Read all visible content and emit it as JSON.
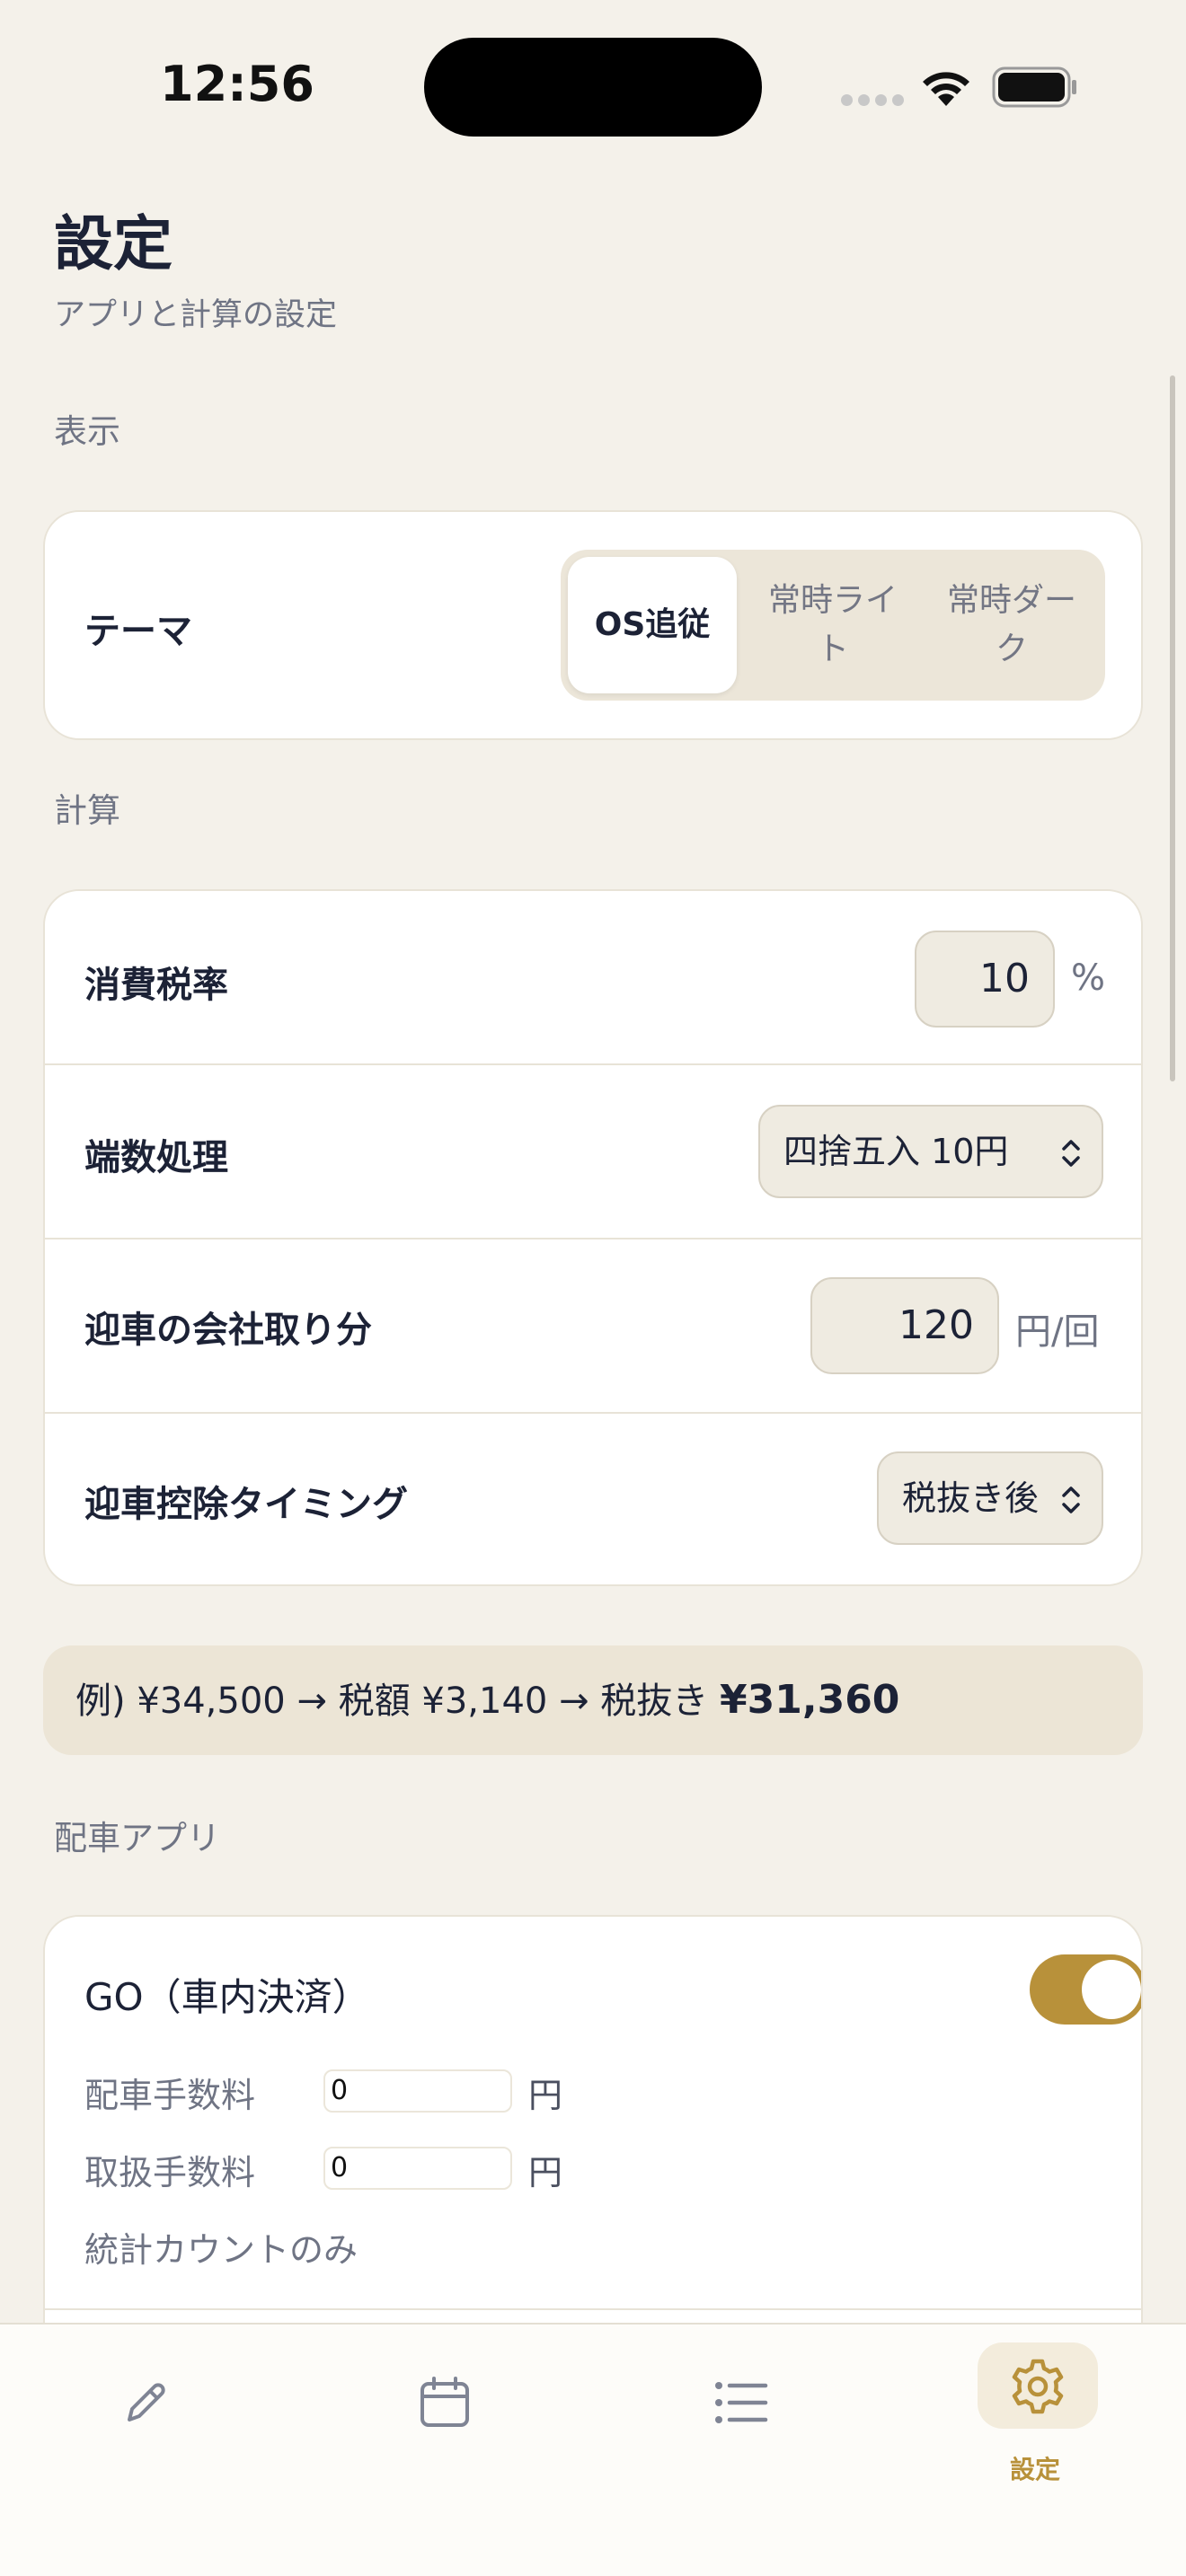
{
  "status_bar": {
    "time": "12:56"
  },
  "header": {
    "title": "設定",
    "subtitle": "アプリと計算の設定"
  },
  "sections": {
    "display": "表示",
    "calc": "計算",
    "dispatch": "配車アプリ"
  },
  "theme": {
    "label": "テーマ",
    "options": [
      "OS追従",
      "常時ライト",
      "常時ダーク"
    ],
    "option_lines": [
      [
        "OS追従"
      ],
      [
        "常時ライ",
        "ト"
      ],
      [
        "常時ダー",
        "ク"
      ]
    ],
    "selected": "OS追従"
  },
  "calc": {
    "tax_rate_label": "消費税率",
    "tax_rate_value": "10",
    "tax_rate_unit": "%",
    "rounding_label": "端数処理",
    "rounding_value": "四捨五入 10円",
    "pickup_fee_label": "迎車の会社取り分",
    "pickup_fee_value": "120",
    "pickup_fee_unit": "円/回",
    "pickup_timing_label": "迎車控除タイミング",
    "pickup_timing_value": "税抜き後"
  },
  "example": {
    "prefix": "例) ¥34,500 → 税額 ¥3,140 → 税抜き ",
    "result": "¥31,360"
  },
  "dispatch_app": {
    "name": "GO（車内決済）",
    "enabled": true,
    "dispatch_fee_label": "配車手数料",
    "dispatch_fee_value": "0",
    "dispatch_fee_unit": "円",
    "handling_fee_label": "取扱手数料",
    "handling_fee_value": "0",
    "handling_fee_unit": "円",
    "note": "統計カウントのみ"
  },
  "tabbar": {
    "items": [
      {
        "icon": "pencil-icon",
        "label": ""
      },
      {
        "icon": "calendar-icon",
        "label": ""
      },
      {
        "icon": "list-icon",
        "label": ""
      },
      {
        "icon": "gear-icon",
        "label": "設定"
      }
    ],
    "active_index": 3
  },
  "colors": {
    "accent": "#b8913a",
    "background": "#f4f1ea",
    "text": "#1c2236",
    "muted": "#6f7484"
  }
}
